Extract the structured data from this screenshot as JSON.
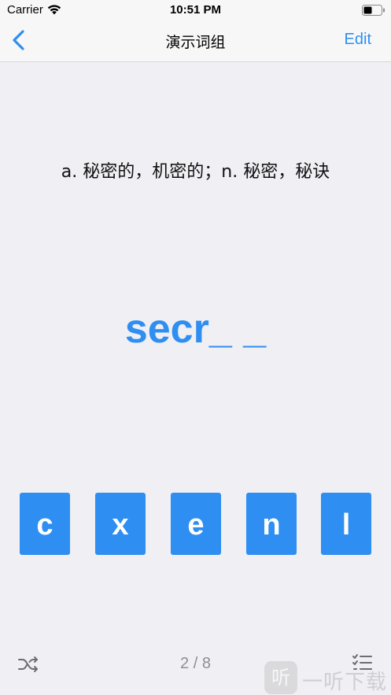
{
  "status_bar": {
    "carrier": "Carrier",
    "time": "10:51 PM"
  },
  "nav": {
    "back_icon": "chevron-left-icon",
    "title": "演示词组",
    "edit_label": "Edit"
  },
  "card": {
    "definition": "a. 秘密的，机密的；n. 秘密，秘诀",
    "word_display": "secr_ _"
  },
  "letter_choices": [
    "c",
    "x",
    "e",
    "n",
    "l"
  ],
  "footer": {
    "shuffle_icon": "shuffle-icon",
    "progress": "2 / 8",
    "list_icon": "checklist-icon"
  },
  "watermark": {
    "badge": "听",
    "text": "一听下载"
  },
  "colors": {
    "accent": "#2f8ef1",
    "background": "#efeff4"
  }
}
